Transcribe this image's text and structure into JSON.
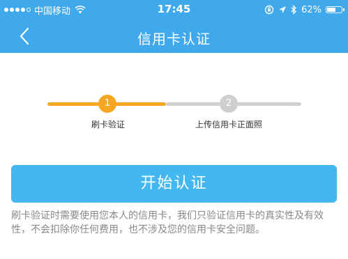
{
  "status_bar": {
    "carrier": "中国移动",
    "time": "17:45",
    "battery": "62%",
    "battery_level": 0.62,
    "icons": [
      "signal-dots",
      "wifi-icon",
      "rotation-lock-icon",
      "location-arrow-icon",
      "bluetooth-icon",
      "battery-icon"
    ]
  },
  "nav": {
    "title": "信用卡认证",
    "back_icon": "chevron-left-icon"
  },
  "steps": [
    {
      "number": "1",
      "label": "刷卡验证",
      "state": "active",
      "color": "#f5a623"
    },
    {
      "number": "2",
      "label": "上传信用卡正面照",
      "state": "pending",
      "color": "#cfcfcf"
    }
  ],
  "progress": 0.47,
  "main": {
    "start_button": "开始认证",
    "notice": "刷卡验证时需要使用您本人的信用卡，我们只验证信用卡的真实性及有效性，不会扣除你任何费用，也不涉及您的信用卡安全问题。"
  },
  "colors": {
    "header": "#3fa9ec",
    "button": "#43b8f0",
    "active_step": "#f5a623"
  }
}
